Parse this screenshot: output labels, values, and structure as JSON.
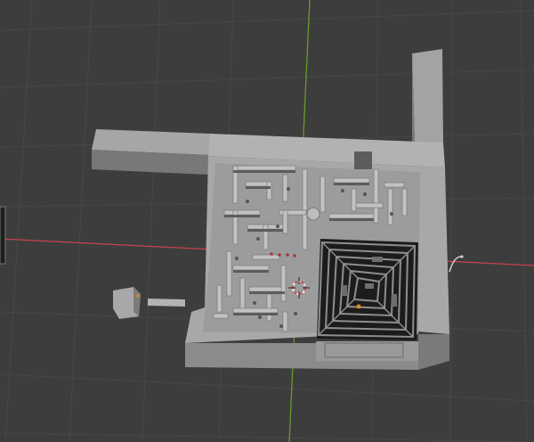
{
  "viewport": {
    "type": "3d-viewport",
    "background_color": "#3d3d3d",
    "grid_color": "#4a4a4a",
    "x_axis_color": "#c9424f",
    "y_axis_color": "#6a9a2a",
    "scene": {
      "objects": [
        "maze-model",
        "cube-object",
        "bar-object",
        "side-wall-object",
        "light-object"
      ],
      "origin_marker": "3d-cursor-icon"
    }
  }
}
